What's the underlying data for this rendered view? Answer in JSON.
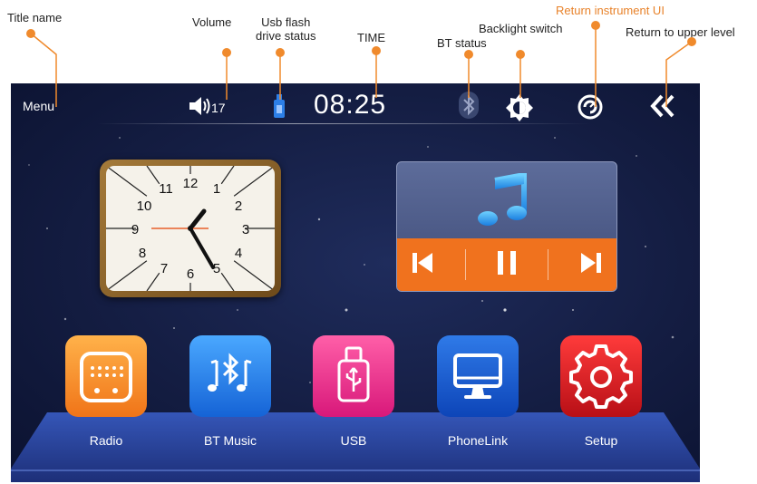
{
  "callouts": {
    "title_name": "Title name",
    "volume": "Volume",
    "usb_status_1": "Usb flash",
    "usb_status_2": "drive status",
    "time": "TIME",
    "bt_status": "BT status",
    "backlight": "Backlight switch",
    "return_ui": "Return instrument UI",
    "return_upper": "Return to upper level"
  },
  "statusbar": {
    "title": "Menu",
    "volume": "17",
    "time": "08:25"
  },
  "clock": {
    "numerals": [
      "12",
      "1",
      "2",
      "3",
      "4",
      "5",
      "6",
      "7",
      "8",
      "9",
      "10",
      "11"
    ]
  },
  "apps": [
    {
      "label": "Radio"
    },
    {
      "label": "BT Music"
    },
    {
      "label": "USB"
    },
    {
      "label": "PhoneLink"
    },
    {
      "label": "Setup"
    }
  ],
  "colors": {
    "accent": "#f0721e",
    "highlight_callout": "#e8822a",
    "background": "#141d42"
  },
  "icons": [
    "speaker-icon",
    "usb-drive-icon",
    "bluetooth-icon",
    "brightness-icon",
    "gauge-icon",
    "double-chevron-left-icon",
    "music-note-icon",
    "previous-icon",
    "pause-icon",
    "next-icon",
    "radio-icon",
    "bt-music-icon",
    "usb-icon",
    "monitor-icon",
    "gear-icon"
  ]
}
